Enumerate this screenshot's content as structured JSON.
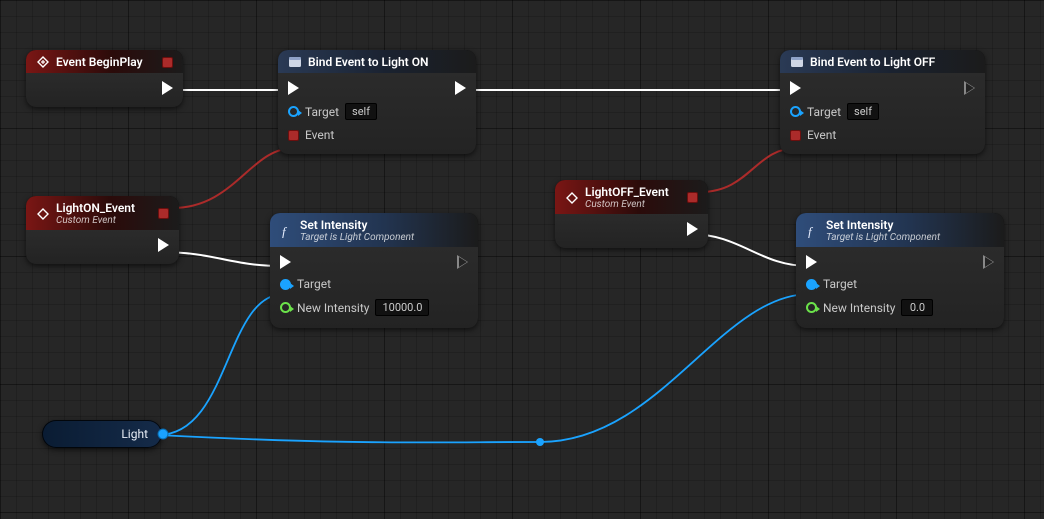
{
  "nodes": {
    "beginplay": {
      "title": "Event BeginPlay"
    },
    "bind_on": {
      "title": "Bind Event to Light ON",
      "target_label": "Target",
      "target_value": "self",
      "event_label": "Event"
    },
    "bind_off": {
      "title": "Bind Event to Light OFF",
      "target_label": "Target",
      "target_value": "self",
      "event_label": "Event"
    },
    "evt_on": {
      "title": "LightON_Event",
      "subtitle": "Custom Event"
    },
    "evt_off": {
      "title": "LightOFF_Event",
      "subtitle": "Custom Event"
    },
    "set_on": {
      "title": "Set Intensity",
      "subtitle": "Target is Light Component",
      "target_label": "Target",
      "intensity_label": "New Intensity",
      "intensity_value": "10000.0"
    },
    "set_off": {
      "title": "Set Intensity",
      "subtitle": "Target is Light Component",
      "target_label": "Target",
      "intensity_label": "New Intensity",
      "intensity_value": "0.0"
    },
    "light_var": {
      "label": "Light"
    }
  },
  "chart_data": {
    "type": "node_graph",
    "engine": "Unreal Engine Blueprint",
    "nodes": [
      {
        "id": "beginplay",
        "kind": "event",
        "label": "Event BeginPlay"
      },
      {
        "id": "bind_on",
        "kind": "bind",
        "label": "Bind Event to Light ON",
        "target": "self"
      },
      {
        "id": "bind_off",
        "kind": "bind",
        "label": "Bind Event to Light OFF",
        "target": "self"
      },
      {
        "id": "evt_on",
        "kind": "custom_event",
        "label": "LightON_Event"
      },
      {
        "id": "evt_off",
        "kind": "custom_event",
        "label": "LightOFF_Event"
      },
      {
        "id": "set_on",
        "kind": "function",
        "label": "Set Intensity",
        "new_intensity": 10000.0
      },
      {
        "id": "set_off",
        "kind": "function",
        "label": "Set Intensity",
        "new_intensity": 0.0
      },
      {
        "id": "light",
        "kind": "variable",
        "label": "Light",
        "var_type": "Light Component"
      }
    ],
    "edges": [
      {
        "from": "beginplay",
        "from_pin": "exec_out",
        "to": "bind_on",
        "to_pin": "exec_in",
        "type": "exec"
      },
      {
        "from": "bind_on",
        "from_pin": "exec_out",
        "to": "bind_off",
        "to_pin": "exec_in",
        "type": "exec"
      },
      {
        "from": "evt_on",
        "from_pin": "delegate",
        "to": "bind_on",
        "to_pin": "Event",
        "type": "delegate"
      },
      {
        "from": "evt_off",
        "from_pin": "delegate",
        "to": "bind_off",
        "to_pin": "Event",
        "type": "delegate"
      },
      {
        "from": "evt_on",
        "from_pin": "exec_out",
        "to": "set_on",
        "to_pin": "exec_in",
        "type": "exec"
      },
      {
        "from": "evt_off",
        "from_pin": "exec_out",
        "to": "set_off",
        "to_pin": "exec_in",
        "type": "exec"
      },
      {
        "from": "light",
        "from_pin": "value",
        "to": "set_on",
        "to_pin": "Target",
        "type": "object"
      },
      {
        "from": "light",
        "from_pin": "value",
        "to": "set_off",
        "to_pin": "Target",
        "type": "object"
      }
    ]
  }
}
